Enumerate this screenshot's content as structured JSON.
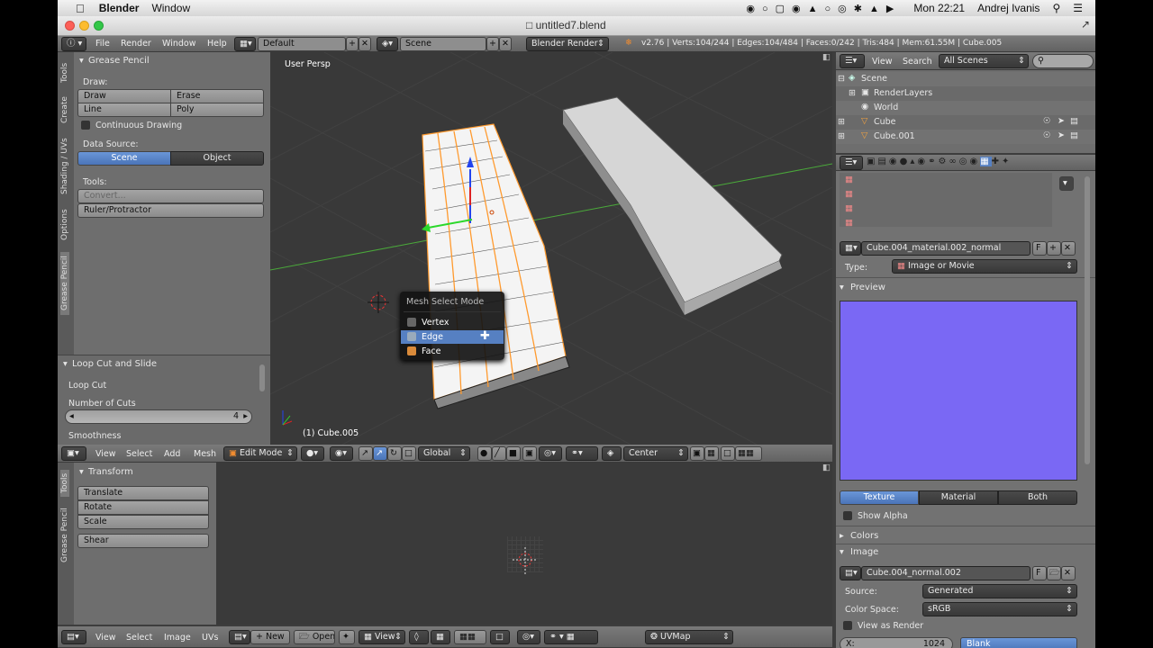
{
  "macbar": {
    "app": "Blender",
    "menu_window": "Window",
    "clock": "Mon 22:21",
    "user": "Andrej Ivanis"
  },
  "window": {
    "title": "untitled7.blend"
  },
  "info_header": {
    "menus": [
      "File",
      "Render",
      "Window",
      "Help"
    ],
    "layout": "Default",
    "scene": "Scene",
    "engine": "Blender Render",
    "stats": "v2.76 | Verts:104/244 | Edges:104/484 | Faces:0/242 | Tris:484 | Mem:61.55M | Cube.005"
  },
  "tool_shelf": {
    "tabs": [
      "Tools",
      "Create",
      "Shading / UVs",
      "Options",
      "Grease Pencil"
    ],
    "panel_title": "Grease Pencil",
    "draw_label": "Draw:",
    "draw_btn": "Draw",
    "erase_btn": "Erase",
    "line_btn": "Line",
    "poly_btn": "Poly",
    "continuous": "Continuous Drawing",
    "data_source_label": "Data Source:",
    "scene_btn": "Scene",
    "object_btn": "Object",
    "tools_label": "Tools:",
    "convert_btn": "Convert...",
    "ruler_btn": "Ruler/Protractor"
  },
  "operator_panel": {
    "title": "Loop Cut and Slide",
    "sub": "Loop Cut",
    "cuts_label": "Number of Cuts",
    "cuts_value": "4",
    "smoothness_label": "Smoothness"
  },
  "viewport": {
    "view_name": "User Persp",
    "object_name": "(1) Cube.005"
  },
  "mesh_select_menu": {
    "title": "Mesh Select Mode",
    "items": [
      "Vertex",
      "Edge",
      "Face"
    ],
    "highlighted": "Edge"
  },
  "view3d_header": {
    "menus": [
      "View",
      "Select",
      "Add",
      "Mesh"
    ],
    "mode": "Edit Mode",
    "orientation": "Global",
    "pivot": "Center"
  },
  "uv_toolshelf": {
    "tabs": [
      "Tools",
      "Grease Pencil"
    ],
    "panel_title": "Transform",
    "buttons": [
      "Translate",
      "Rotate",
      "Scale",
      "Shear"
    ]
  },
  "uv_header": {
    "menus": [
      "View",
      "Select",
      "Image",
      "UVs"
    ],
    "new_btn": "New",
    "open_btn": "Open",
    "view_btn": "View",
    "uvmap": "UVMap"
  },
  "outliner": {
    "view_menu": "View",
    "search_menu": "Search",
    "filter": "All Scenes",
    "rows": [
      {
        "label": "Scene"
      },
      {
        "label": "RenderLayers"
      },
      {
        "label": "World"
      },
      {
        "label": "Cube"
      },
      {
        "label": "Cube.001"
      }
    ]
  },
  "properties": {
    "texture_name": "Cube.004_material.002_normal",
    "type_label": "Type:",
    "type_value": "Image or Movie",
    "preview_label": "Preview",
    "preview_color": "#7a68f4",
    "tabs": [
      "Texture",
      "Material",
      "Both"
    ],
    "show_alpha": "Show Alpha",
    "colors_section": "Colors",
    "image_section": "Image",
    "image_name": "Cube.004_normal.002",
    "source_label": "Source:",
    "source_value": "Generated",
    "colorspace_label": "Color Space:",
    "colorspace_value": "sRGB",
    "view_as_render": "View as Render",
    "x_label": "X:",
    "x_value": "1024",
    "blank": "Blank",
    "f_label": "F"
  }
}
